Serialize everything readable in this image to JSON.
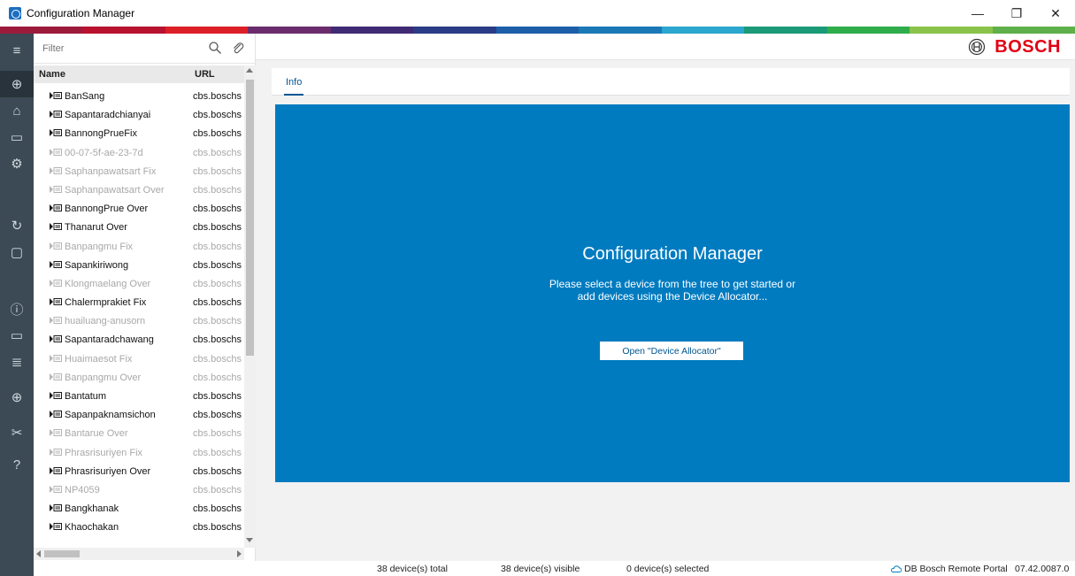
{
  "window": {
    "title": "Configuration Manager",
    "controls": {
      "minimize": "—",
      "maximize": "❐",
      "close": "✕"
    }
  },
  "colors": {
    "rail_bg": "#3b4a55",
    "hero_bg": "#007bc0",
    "brand_red": "#e20015",
    "link_blue": "#005691",
    "band": [
      "#9c1b3c",
      "#b8122e",
      "#dc1f26",
      "#6b2c6e",
      "#3f2a74",
      "#2a3c86",
      "#1c5fa8",
      "#1b79b8",
      "#2aa6cf",
      "#1b9a78",
      "#2fad4b",
      "#8bc34a",
      "#5fb04a"
    ]
  },
  "rail": {
    "items": [
      {
        "name": "menu-icon",
        "glyph": "≡"
      },
      {
        "name": "network-icon",
        "glyph": "⊕"
      },
      {
        "name": "devices-icon",
        "glyph": "⌂"
      },
      {
        "name": "camera-icon",
        "glyph": "▭"
      },
      {
        "name": "settings-icon",
        "glyph": "⚙"
      },
      {
        "name": "refresh-icon",
        "glyph": "↻"
      },
      {
        "name": "save-icon",
        "glyph": "▢"
      },
      {
        "name": "info-icon",
        "glyph": "ⓘ"
      },
      {
        "name": "monitor-icon",
        "glyph": "▭"
      },
      {
        "name": "database-icon",
        "glyph": "≣"
      },
      {
        "name": "globe-icon",
        "glyph": "⊕"
      },
      {
        "name": "tools-icon",
        "glyph": "✂"
      },
      {
        "name": "help-icon",
        "glyph": "?"
      }
    ]
  },
  "filter": {
    "placeholder": "Filter"
  },
  "list": {
    "columns": {
      "name": "Name",
      "url": "URL"
    },
    "rows": [
      {
        "name": "BanSang",
        "url": "cbs.boschs",
        "online": true
      },
      {
        "name": "Sapantaradchianyai",
        "url": "cbs.boschs",
        "online": true
      },
      {
        "name": "BannongPrueFix",
        "url": "cbs.boschs",
        "online": true
      },
      {
        "name": "00-07-5f-ae-23-7d",
        "url": "cbs.boschs",
        "online": false
      },
      {
        "name": "Saphanpawatsart Fix",
        "url": "cbs.boschs",
        "online": false
      },
      {
        "name": "Saphanpawatsart Over",
        "url": "cbs.boschs",
        "online": false
      },
      {
        "name": "BannongPrue Over",
        "url": "cbs.boschs",
        "online": true
      },
      {
        "name": "Thanarut Over",
        "url": "cbs.boschs",
        "online": true
      },
      {
        "name": "Banpangmu Fix",
        "url": "cbs.boschs",
        "online": false
      },
      {
        "name": "Sapankiriwong",
        "url": "cbs.boschs",
        "online": true
      },
      {
        "name": "Klongmaelang Over",
        "url": "cbs.boschs",
        "online": false
      },
      {
        "name": "Chalermprakiet Fix",
        "url": "cbs.boschs",
        "online": true
      },
      {
        "name": "huailuang-anusorn",
        "url": "cbs.boschs",
        "online": false
      },
      {
        "name": "Sapantaradchawang",
        "url": "cbs.boschs",
        "online": true
      },
      {
        "name": "Huaimaesot Fix",
        "url": "cbs.boschs",
        "online": false
      },
      {
        "name": "Banpangmu Over",
        "url": "cbs.boschs",
        "online": false
      },
      {
        "name": "Bantatum",
        "url": "cbs.boschs",
        "online": true
      },
      {
        "name": "Sapanpaknamsichon",
        "url": "cbs.boschs",
        "online": true
      },
      {
        "name": "Bantarue Over",
        "url": "cbs.boschs",
        "online": false
      },
      {
        "name": "Phrasrisuriyen Fix",
        "url": "cbs.boschs",
        "online": false
      },
      {
        "name": "Phrasrisuriyen Over",
        "url": "cbs.boschs",
        "online": true
      },
      {
        "name": "NP4059",
        "url": "cbs.boschs",
        "online": false
      },
      {
        "name": "Bangkhanak",
        "url": "cbs.boschs",
        "online": true
      },
      {
        "name": "Khaochakan",
        "url": "cbs.boschs",
        "online": true
      }
    ]
  },
  "brand": {
    "name": "BOSCH"
  },
  "tabs": [
    {
      "label": "Info"
    }
  ],
  "hero": {
    "title": "Configuration Manager",
    "line1": "Please select a device from the tree to get started or",
    "line2": "add devices using the Device Allocator...",
    "button": "Open \"Device Allocator\""
  },
  "status": {
    "total": "38 device(s) total",
    "visible": "38 device(s) visible",
    "selected": "0 device(s) selected",
    "portal": "DB Bosch Remote Portal",
    "version": "07.42.0087.0"
  }
}
